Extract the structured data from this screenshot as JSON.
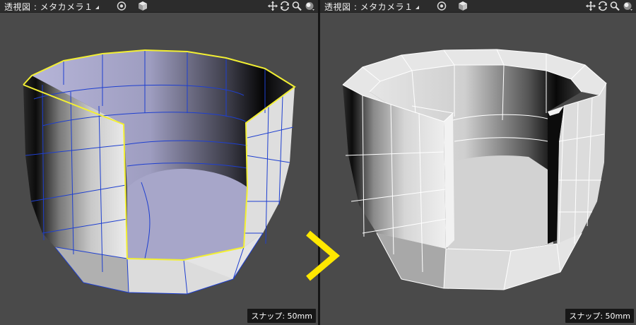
{
  "left_viewport": {
    "title": "透視図 : メタカメラ１",
    "snap_status": "スナップ: 50mm"
  },
  "right_viewport": {
    "title": "透視図 : メタカメラ１",
    "snap_status": "スナップ: 50mm"
  },
  "toolbar_icons": [
    "target-icon",
    "cube-icon",
    "pan-icon",
    "rotate-icon",
    "zoom-icon",
    "shading-sphere-icon"
  ],
  "colors": {
    "viewport_bg": "#4a4a4a",
    "selection_edge": "#f2ef33",
    "wire_edge": "#1e3fd0",
    "selected_face": "#a7a6c9",
    "arrow": "#ffe800"
  }
}
